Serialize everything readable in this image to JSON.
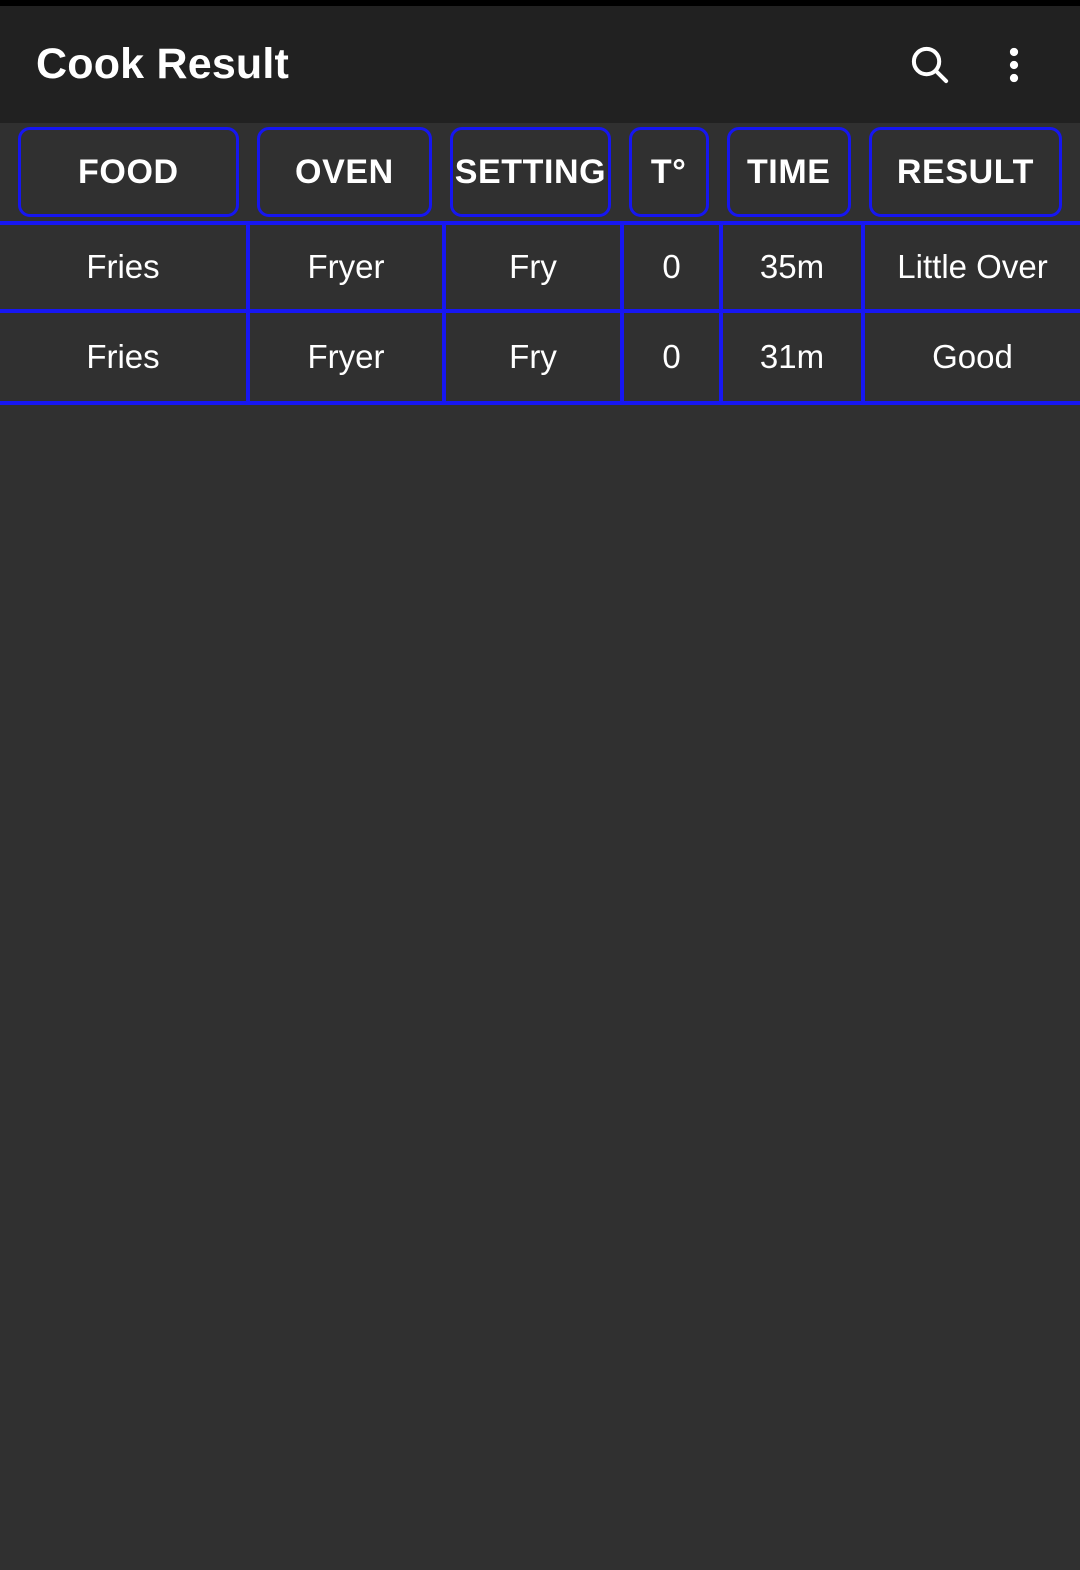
{
  "app": {
    "title": "Cook Result",
    "background_color": "#303030",
    "toolbar_color": "#212121",
    "accent_color": "#1717f2",
    "text_color": "#ffffff"
  },
  "toolbar": {
    "title": "Cook Result",
    "actions": [
      {
        "name": "search-icon",
        "label": "Search"
      },
      {
        "name": "overflow-menu-icon",
        "label": "More options"
      }
    ]
  },
  "table": {
    "columns": [
      {
        "key": "food",
        "label": "FOOD"
      },
      {
        "key": "oven",
        "label": "OVEN"
      },
      {
        "key": "setting",
        "label": "SETTING"
      },
      {
        "key": "temp",
        "label": "T°"
      },
      {
        "key": "time",
        "label": "TIME"
      },
      {
        "key": "result",
        "label": "RESULT"
      }
    ],
    "rows": [
      {
        "food": "Fries",
        "oven": "Fryer",
        "setting": "Fry",
        "temp": "0",
        "time": "35m",
        "result": "Little Over"
      },
      {
        "food": "Fries",
        "oven": "Fryer",
        "setting": "Fry",
        "temp": "0",
        "time": "31m",
        "result": "Good"
      }
    ]
  }
}
